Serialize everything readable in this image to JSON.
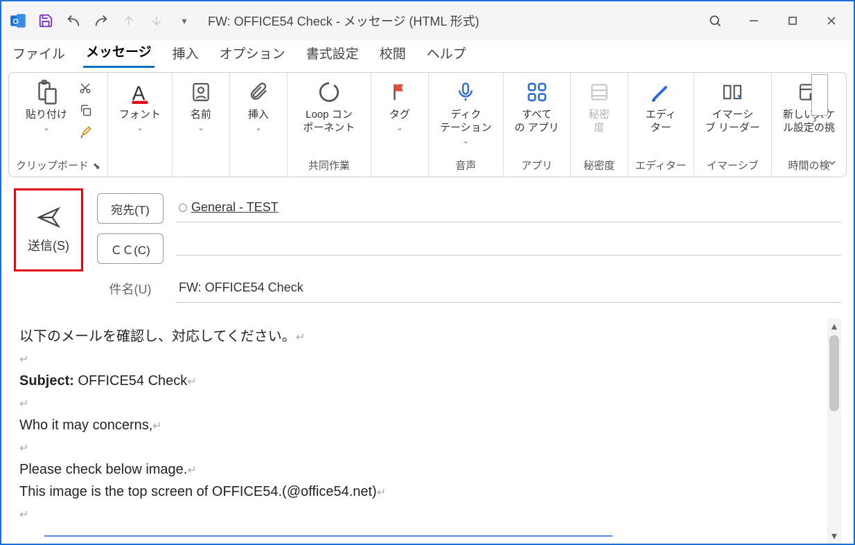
{
  "titlebar": {
    "title": "FW: OFFICE54 Check  -  メッセージ (HTML 形式)"
  },
  "menu": {
    "items": [
      "ファイル",
      "メッセージ",
      "挿入",
      "オプション",
      "書式設定",
      "校閲",
      "ヘルプ"
    ],
    "active_index": 1
  },
  "ribbon": {
    "groups": [
      {
        "label": "クリップボード",
        "buttons": [
          {
            "label": "貼り付け",
            "icon": "paste"
          }
        ],
        "has_mini": true
      },
      {
        "label": "",
        "buttons": [
          {
            "label": "フォント",
            "icon": "font"
          }
        ]
      },
      {
        "label": "",
        "buttons": [
          {
            "label": "名前",
            "icon": "names"
          }
        ]
      },
      {
        "label": "",
        "buttons": [
          {
            "label": "挿入",
            "icon": "attach"
          }
        ]
      },
      {
        "label": "共同作業",
        "buttons": [
          {
            "label": "Loop コン\nポーネント",
            "icon": "loop"
          }
        ]
      },
      {
        "label": "",
        "buttons": [
          {
            "label": "タグ",
            "icon": "tag"
          }
        ]
      },
      {
        "label": "音声",
        "buttons": [
          {
            "label": "ディク\nテーション",
            "icon": "mic"
          }
        ]
      },
      {
        "label": "アプリ",
        "buttons": [
          {
            "label": "すべて\nの アプリ",
            "icon": "apps"
          }
        ]
      },
      {
        "label": "秘密度",
        "buttons": [
          {
            "label": "秘密\n度",
            "icon": "sensitivity",
            "disabled": true
          }
        ]
      },
      {
        "label": "エディター",
        "buttons": [
          {
            "label": "エディ\nター",
            "icon": "editor"
          }
        ]
      },
      {
        "label": "イマーシブ",
        "buttons": [
          {
            "label": "イマーシ\nブ リーダー",
            "icon": "reader"
          }
        ]
      },
      {
        "label": "時間の検",
        "buttons": [
          {
            "label": "新しいスケ\nル設定の挑",
            "icon": "calendar"
          }
        ]
      }
    ]
  },
  "compose": {
    "send_label": "送信(S)",
    "to_button": "宛先(T)",
    "cc_button": "ＣＣ(C)",
    "subject_label": "件名(U)",
    "to_value": "General - TEST",
    "cc_value": "",
    "subject_value": "FW: OFFICE54 Check"
  },
  "body": {
    "line1": "以下のメールを確認し、対応してください。",
    "subject_prefix": "Subject: ",
    "subject_text": "OFFICE54 Check",
    "line2": "Who it may concerns,",
    "line3": "Please check below image.",
    "line4": "This image is the top screen of OFFICE54.(@office54.net)"
  }
}
